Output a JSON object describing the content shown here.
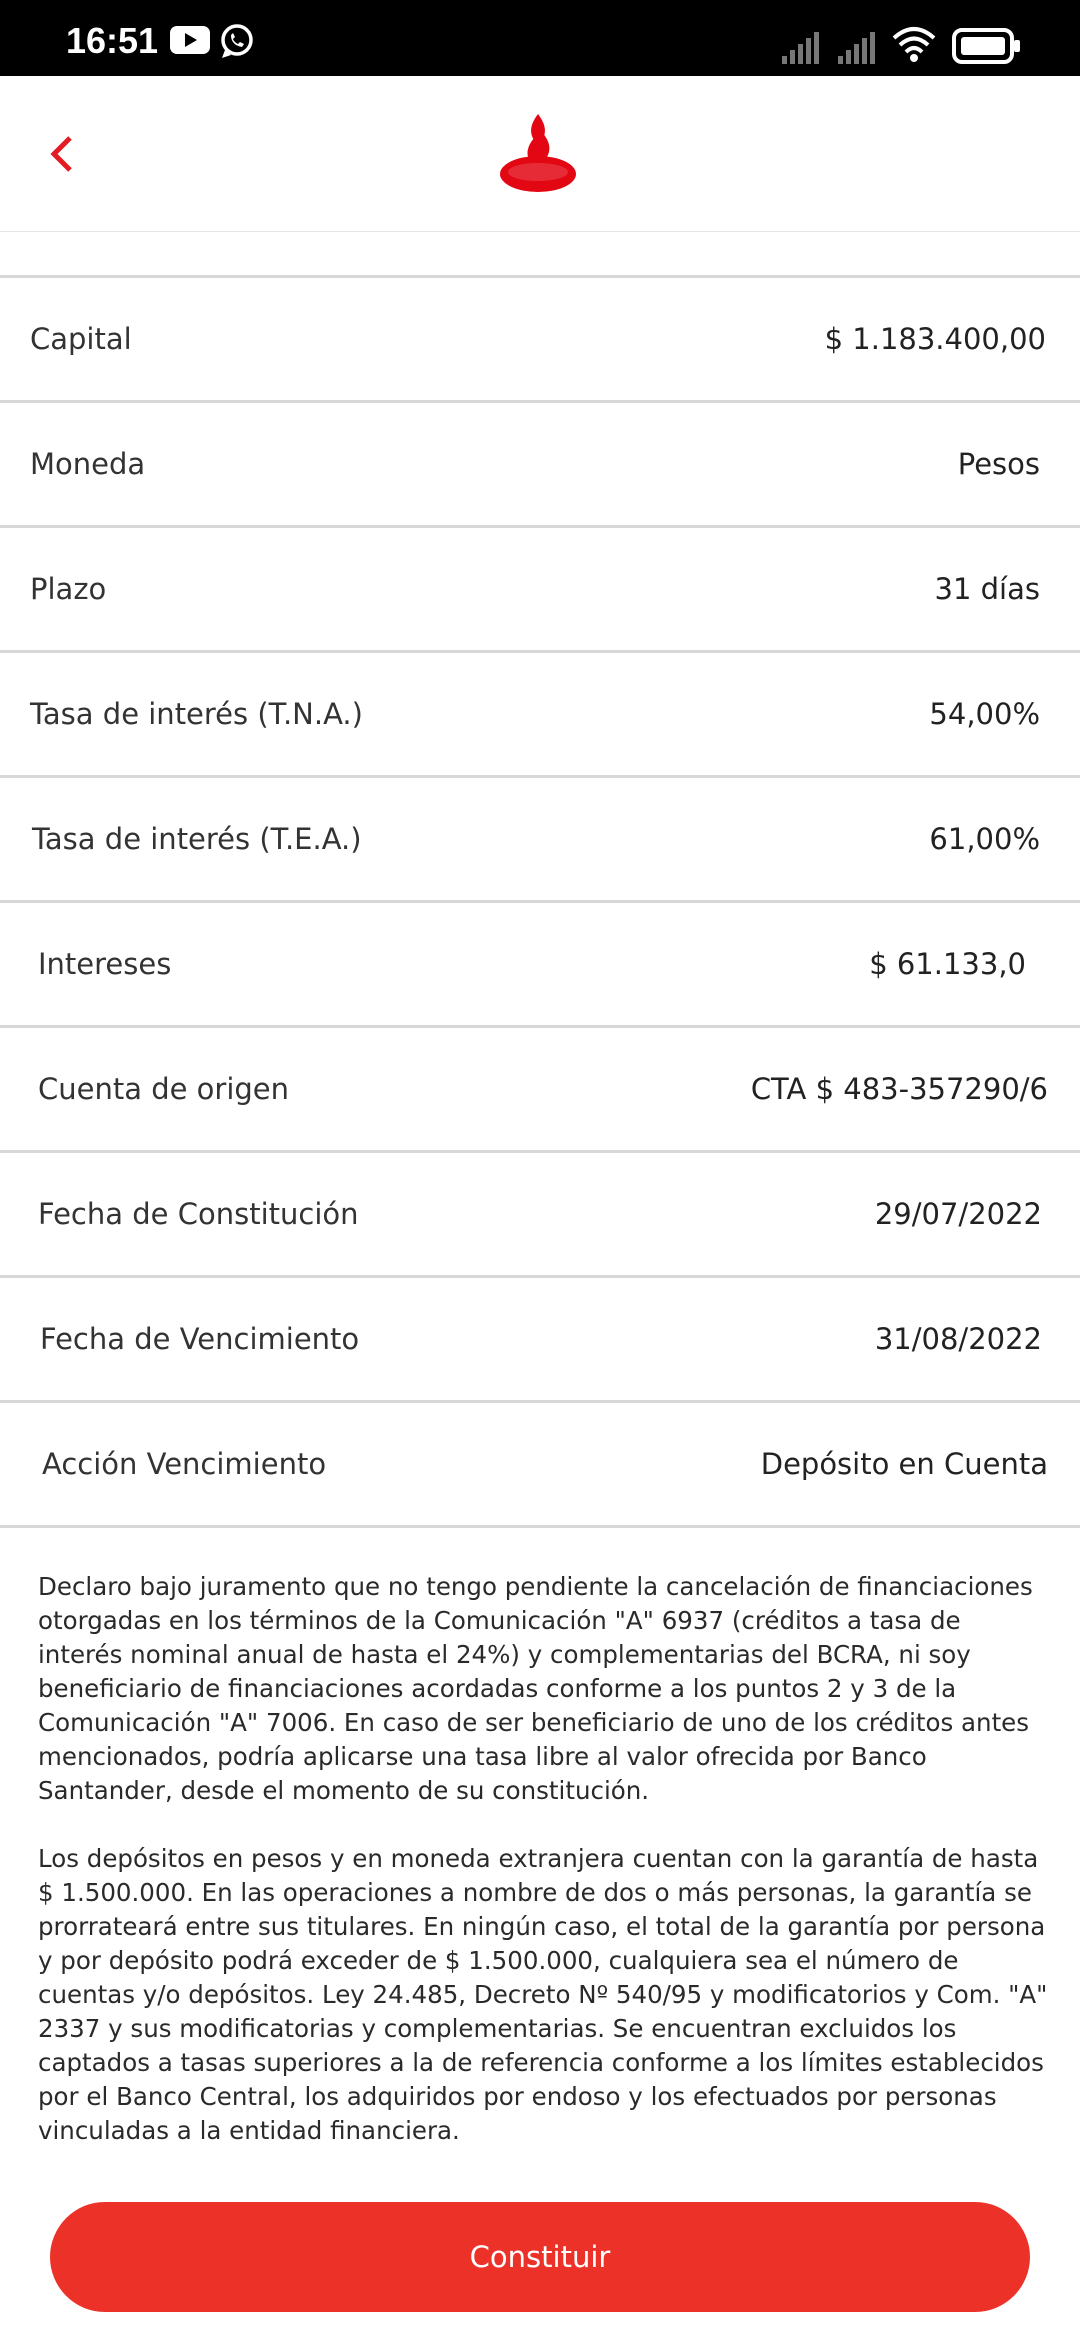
{
  "status_bar": {
    "time": "16:51",
    "icons": [
      "youtube-icon",
      "whatsapp-icon",
      "signal-icon",
      "signal-icon",
      "wifi-icon",
      "battery-icon"
    ]
  },
  "header": {
    "back_icon": "chevron-left-icon",
    "logo": "santander-flame-logo",
    "brand_color": "#ec0000"
  },
  "rows": [
    {
      "label": "Capital",
      "value": "$ 1.183.400,00"
    },
    {
      "label": "Moneda",
      "value": "Pesos"
    },
    {
      "label": "Plazo",
      "value": "31 días"
    },
    {
      "label": "Tasa de interés (T.N.A.)",
      "value": "54,00%"
    },
    {
      "label": "Tasa de interés (T.E.A.)",
      "value": "61,00%"
    },
    {
      "label": "Intereses",
      "value": "$ 61.133,0"
    },
    {
      "label": "Cuenta de origen",
      "value": "CTA $ 483-357290/6"
    },
    {
      "label": "Fecha de Constitución",
      "value": "29/07/2022"
    },
    {
      "label": "Fecha de Vencimiento",
      "value": "31/08/2022"
    },
    {
      "label": "Acción Vencimiento",
      "value": "Depósito en Cuenta"
    }
  ],
  "disclaimer": {
    "paragraph_1": "Declaro bajo juramento que no tengo pendiente la cancelación de financiaciones otorgadas en los términos de la Comunicación \"A\" 6937 (créditos a tasa de interés nominal anual de hasta el 24%) y complementarias del BCRA, ni soy beneficiario de financiaciones acordadas conforme a los puntos 2 y 3 de la Comunicación \"A\" 7006. En caso de ser beneficiario de uno de los créditos antes mencionados, podría aplicarse una tasa libre al valor ofrecida por Banco Santander, desde el momento de su constitución.",
    "paragraph_2": "Los depósitos en pesos y en moneda extranjera cuentan con la garantía de hasta $ 1.500.000. En las operaciones a nombre de dos o más personas, la garantía se prorrateará entre sus titulares. En ningún caso, el total de la garantía por persona y por depósito podrá exceder de $ 1.500.000, cualquiera sea el número de cuentas y/o depósitos. Ley 24.485, Decreto Nº 540/95 y modificatorios y Com. \"A\" 2337 y sus modificatorias y complementarias. Se encuentran excluidos los captados a tasas superiores a la de referencia conforme a los límites establecidos por el Banco Central, los adquiridos por endoso y los efectuados por personas vinculadas a la entidad financiera."
  },
  "cta": {
    "label": "Constituir",
    "color": "#ec3129"
  }
}
